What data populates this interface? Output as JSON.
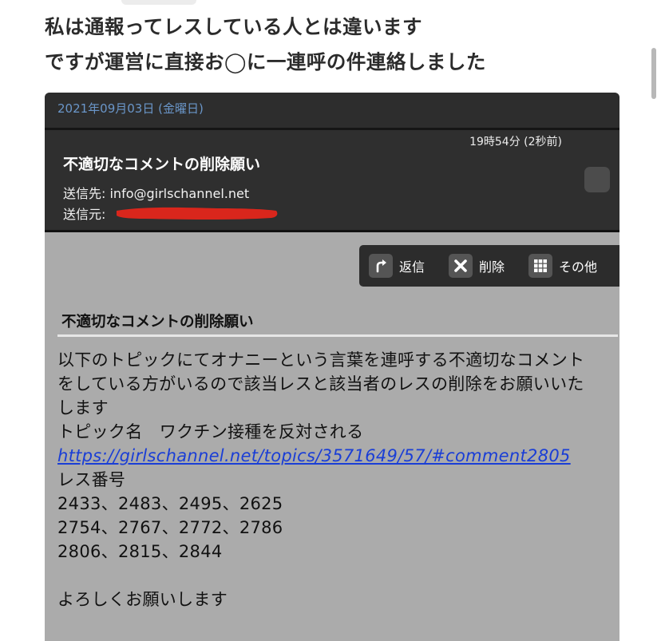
{
  "post": {
    "line1": "私は通報ってレスしている人とは違います",
    "line2": "ですが運営に直接お◯に一連呼の件連絡しました"
  },
  "mail": {
    "date": "2021年09月03日 (金曜日)",
    "time": "19時54分 (2秒前)",
    "subject": "不適切なコメントの削除願い",
    "to": "送信先: info@girlschannel.net",
    "from_label": "送信元:",
    "actions": {
      "reply": "返信",
      "delete": "削除",
      "more": "その他"
    },
    "body": {
      "subject": "不適切なコメントの削除願い",
      "line1": "以下のトピックにてオナニーという言葉を連呼する不適切なコメント",
      "line2": "をしている方がいるので該当レスと該当者のレスの削除をお願いいた",
      "line3": "します",
      "topic_line": "トピック名　ワクチン接種を反対される",
      "link": "https://girlschannel.net/topics/3571649/57/#comment2805",
      "res_label": "レス番号",
      "numbers1": "2433、2483、2495、2625",
      "numbers2": "2754、2767、2772、2786",
      "numbers3": "2806、2815、2844",
      "closing": "よろしくお願いします"
    }
  },
  "colors": {
    "date_text": "#6a96c9",
    "header_bg": "#2f2f2f",
    "body_bg": "#ababab",
    "link": "#1a3ed6",
    "redaction": "#d9261c"
  }
}
